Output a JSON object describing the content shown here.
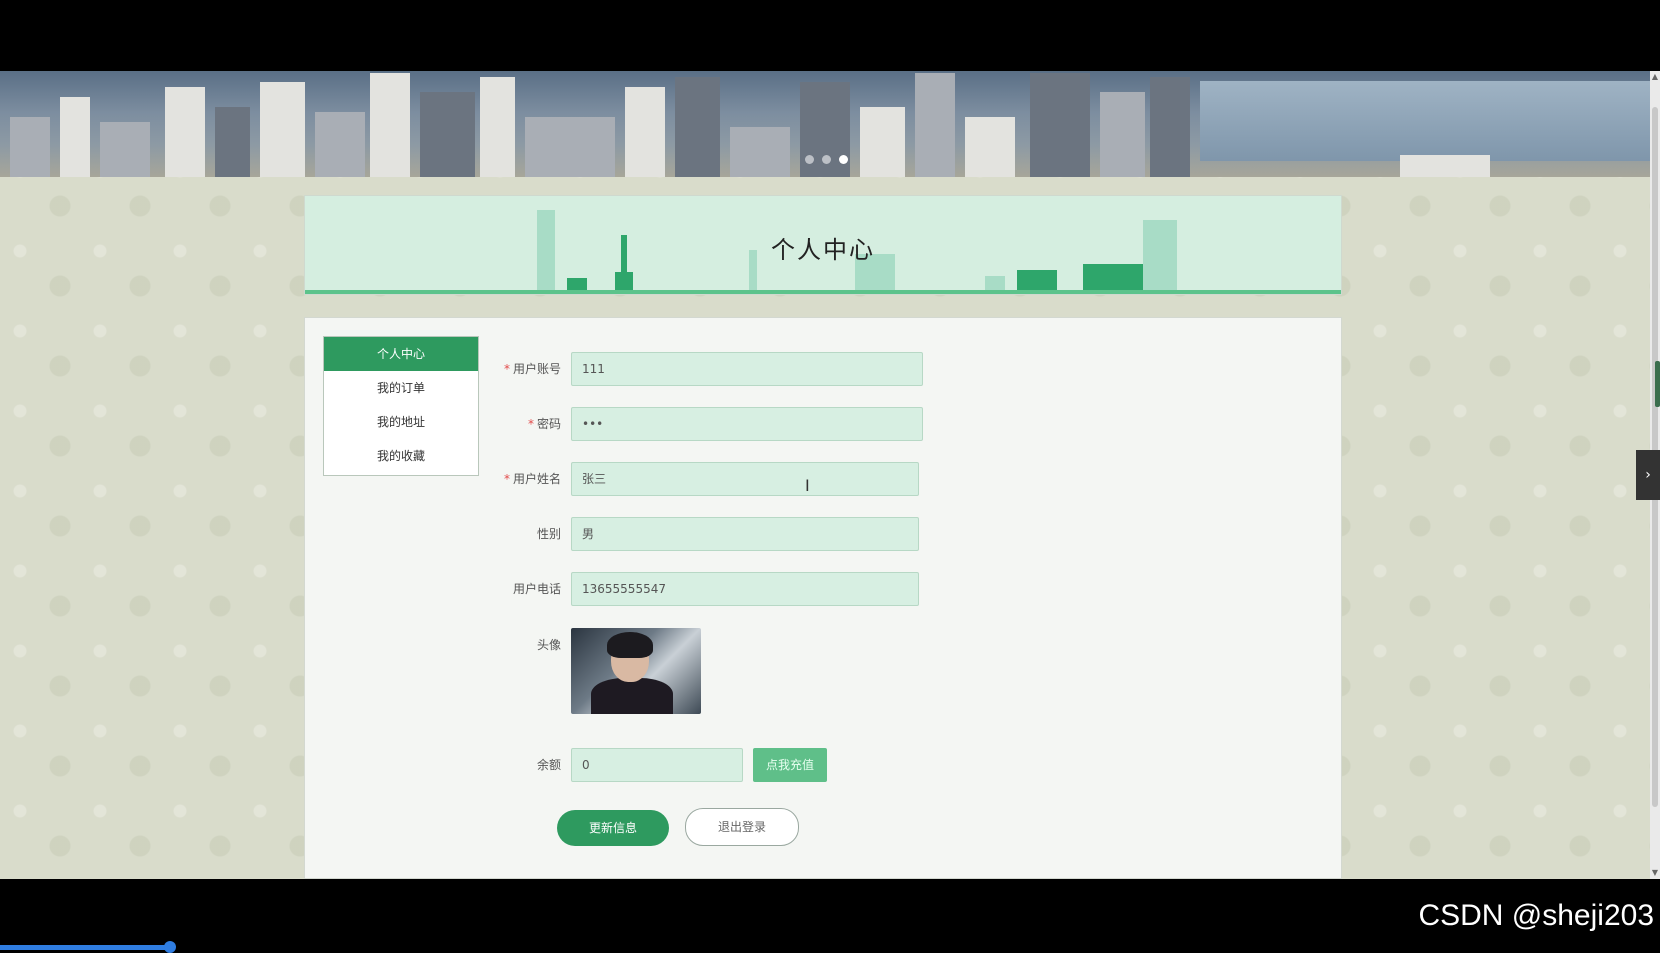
{
  "banner": {
    "slides_count": 3,
    "active_slide": 3
  },
  "page": {
    "title": "个人中心"
  },
  "menu": {
    "items": [
      {
        "label": "个人中心",
        "active": true
      },
      {
        "label": "我的订单",
        "active": false
      },
      {
        "label": "我的地址",
        "active": false
      },
      {
        "label": "我的收藏",
        "active": false
      }
    ]
  },
  "form": {
    "account": {
      "label": "用户账号",
      "required": true,
      "value": "111"
    },
    "password": {
      "label": "密码",
      "required": true,
      "value": "•••"
    },
    "name": {
      "label": "用户姓名",
      "required": true,
      "value": "张三"
    },
    "gender": {
      "label": "性别",
      "required": false,
      "value": "男"
    },
    "phone": {
      "label": "用户电话",
      "required": false,
      "value": "13655555547"
    },
    "avatar": {
      "label": "头像"
    },
    "balance": {
      "label": "余额",
      "value": "0",
      "recharge_label": "点我充值"
    }
  },
  "actions": {
    "update_label": "更新信息",
    "logout_label": "退出登录"
  },
  "footer": {
    "watermark": "CSDN @sheji203"
  },
  "colors": {
    "accent": "#2e9a5f",
    "input_bg": "#d7efe2",
    "title_bg": "#d5eee0"
  }
}
